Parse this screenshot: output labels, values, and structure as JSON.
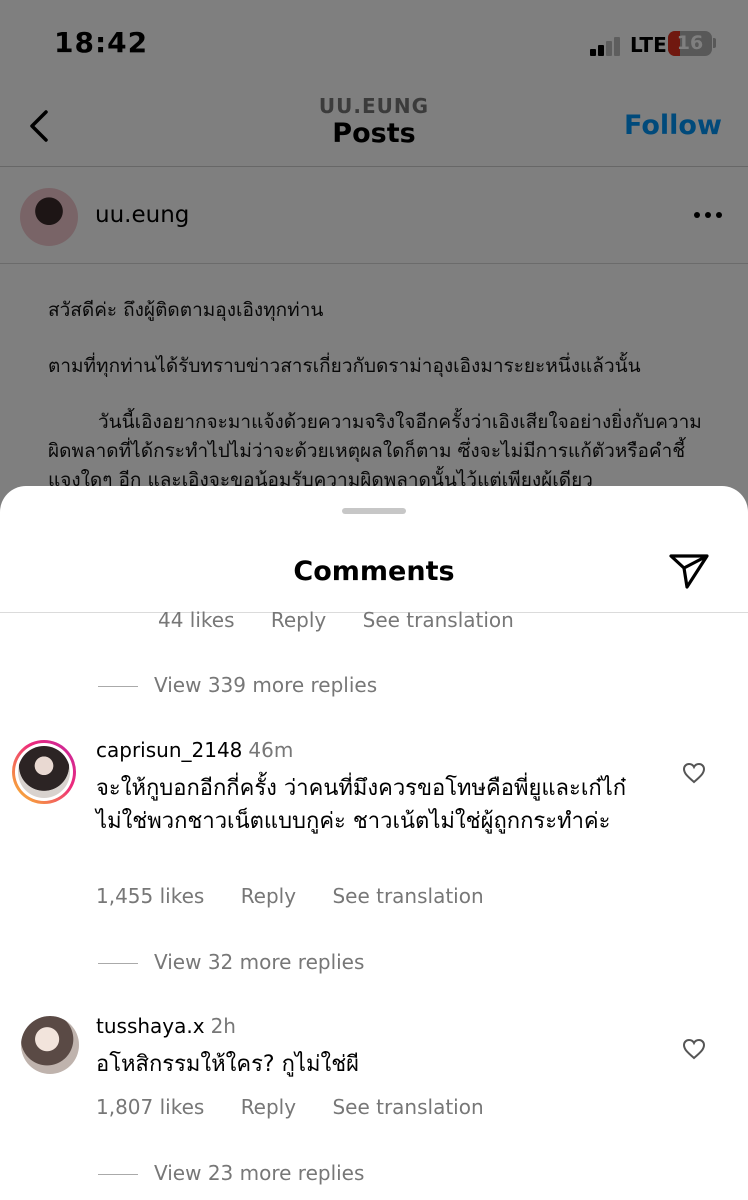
{
  "status_bar": {
    "time": "18:42",
    "network": "LTE",
    "battery": "16"
  },
  "header": {
    "account": "UU.EUNG",
    "title": "Posts",
    "follow_label": "Follow"
  },
  "post": {
    "username": "uu.eung",
    "caption": [
      "สวัสดีค่ะ ถึงผู้ติดตามอุงเอิงทุกท่าน",
      "ตามที่ทุกท่านได้รับทราบข่าวสารเกี่ยวกับดราม่าอุงเอิงมาระยะหนึ่งแล้วนั้น",
      "วันนี้เอิงอยากจะมาแจ้งด้วยความจริงใจอีกครั้งว่าเอิงเสียใจอย่างยิ่งกับความผิดพลาดที่ได้กระทำไปไม่ว่าจะด้วยเหตุผลใดก็ตาม ซึ่งจะไม่มีการแก้ตัวหรือคำชี้แจงใดๆ อีก และเอิงจะขอน้อมรับความผิดพลาดนั้นไว้แต่เพียงผู้เดียว"
    ]
  },
  "comments_sheet": {
    "title": "Comments",
    "top_meta": {
      "likes": "44 likes",
      "reply": "Reply",
      "translate": "See translation"
    },
    "top_view_replies": "View 339 more replies",
    "comments": [
      {
        "username": "caprisun_2148",
        "time": "46m",
        "text": "จะให้กูบอกอีกกี่ครั้ง ว่าคนที่มึงควรขอโทษคือพี่ยูและเก๋ไก๋ ไม่ใช่พวกชาวเน็ตแบบกูค่ะ ชาวเน้ตไม่ใช่ผู้ถูกกระทำค่ะ",
        "likes": "1,455 likes",
        "reply": "Reply",
        "translate": "See translation",
        "view_replies": "View 32 more replies"
      },
      {
        "username": "tusshaya.x",
        "time": "2h",
        "text": "อโหสิกรรมให้ใคร? กูไม่ใช่ผี",
        "likes": "1,807 likes",
        "reply": "Reply",
        "translate": "See translation",
        "view_replies": "View 23 more replies"
      }
    ]
  },
  "icons": [
    "back-icon",
    "more-icon",
    "send-icon",
    "heart-icon",
    "signal-icon",
    "battery-icon"
  ],
  "colors": {
    "accent": "#0095f6",
    "battery_low": "#e0301e",
    "secondary_text": "#777777"
  }
}
